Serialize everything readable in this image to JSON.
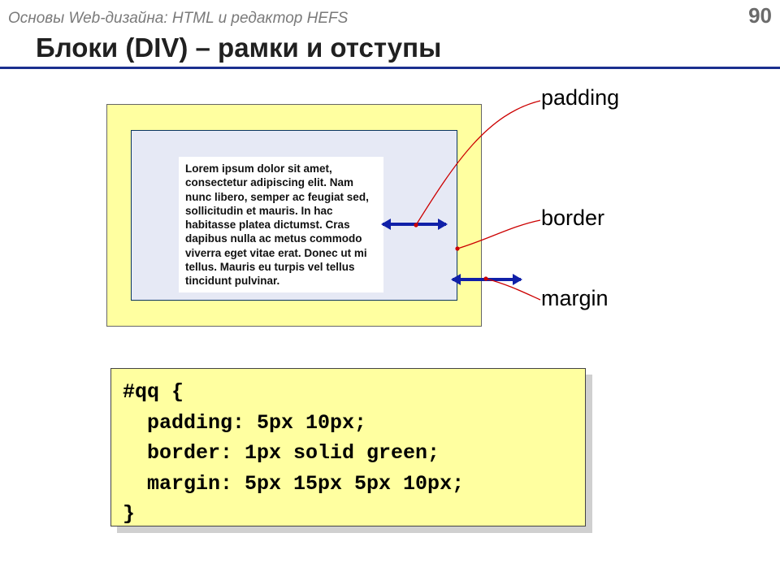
{
  "header": {
    "course": "Основы Web-дизайна: HTML и редактор HEFS",
    "page": "90"
  },
  "title": "Блоки (DIV) – рамки и отступы",
  "lorem": "Lorem ipsum dolor sit amet, consectetur adipiscing elit. Nam nunc libero, semper ac feugiat sed, sollicitudin et mauris. In hac habitasse platea dictumst. Cras dapibus nulla ac metus commodo viverra eget vitae erat. Donec ut mi tellus. Mauris eu turpis vel tellus tincidunt pulvinar.",
  "labels": {
    "padding": "padding",
    "border": "border",
    "margin": "margin"
  },
  "code": "#qq {\n  padding: 5px 10px;\n  border: 1px solid green;\n  margin: 5px 15px 5px 10px;\n}"
}
